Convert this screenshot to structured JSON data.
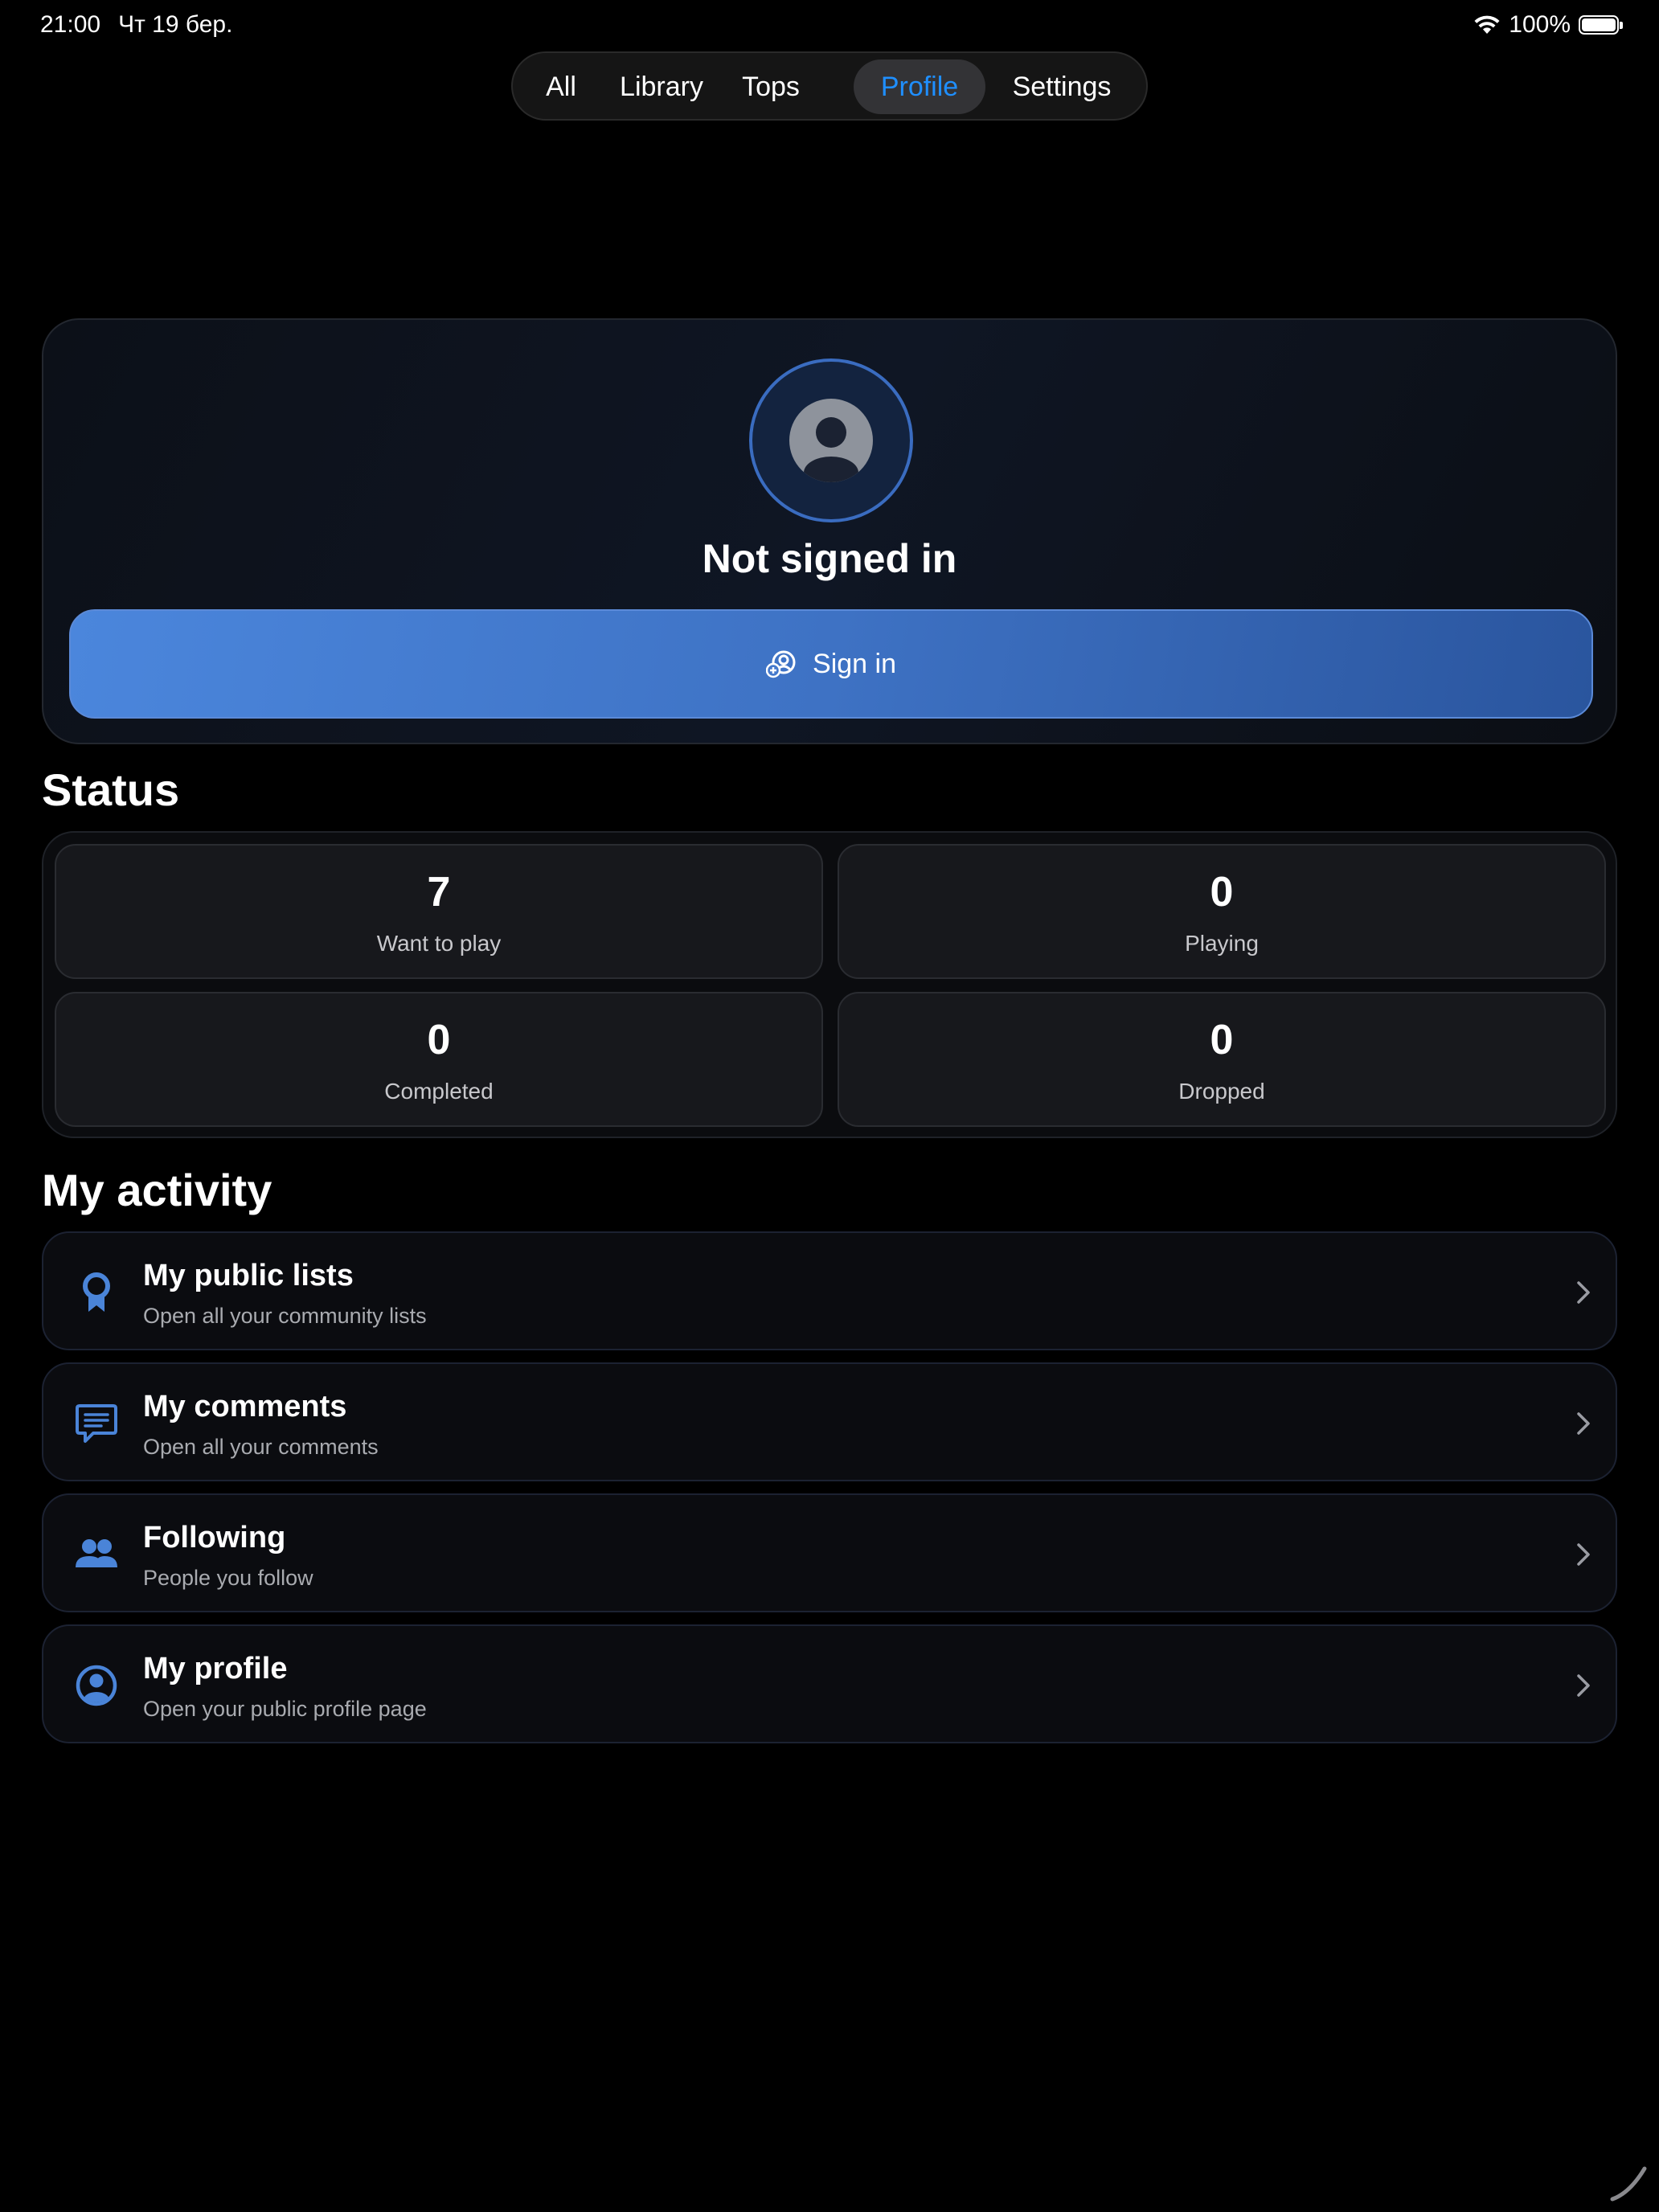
{
  "status_bar": {
    "time": "21:00",
    "date": "Чт 19 бер.",
    "battery": "100%"
  },
  "tabs": [
    {
      "label": "All"
    },
    {
      "label": "Library"
    },
    {
      "label": "Tops"
    },
    {
      "label": "Profile",
      "active": true
    },
    {
      "label": "Settings"
    }
  ],
  "profile": {
    "status_text": "Not signed in",
    "signin_label": "Sign in"
  },
  "status_section": {
    "title": "Status",
    "items": [
      {
        "value": "7",
        "label": "Want to play"
      },
      {
        "value": "0",
        "label": "Playing"
      },
      {
        "value": "0",
        "label": "Completed"
      },
      {
        "value": "0",
        "label": "Dropped"
      }
    ]
  },
  "activity": {
    "title": "My activity",
    "items": [
      {
        "icon": "award-ribbon-icon",
        "title": "My public lists",
        "subtitle": "Open all your community lists"
      },
      {
        "icon": "comment-bubble-icon",
        "title": "My comments",
        "subtitle": "Open all your comments"
      },
      {
        "icon": "people-icon",
        "title": "Following",
        "subtitle": "People you follow"
      },
      {
        "icon": "person-circle-icon",
        "title": "My profile",
        "subtitle": "Open your public profile page"
      }
    ]
  },
  "colors": {
    "accent": "#1f8fff",
    "icon_blue": "#4a84d8",
    "button_blue": "#4b86dc"
  }
}
